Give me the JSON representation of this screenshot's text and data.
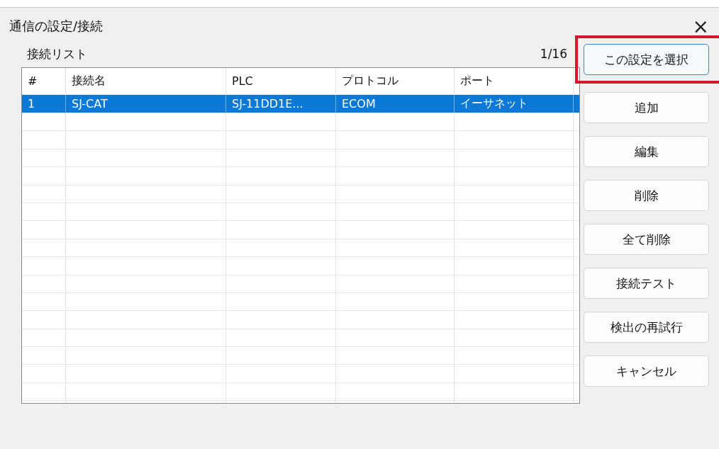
{
  "window": {
    "title": "通信の設定/接続",
    "close": "×"
  },
  "list": {
    "label": "接続リスト",
    "count": "1/16",
    "columns": [
      "#",
      "接続名",
      "PLC",
      "プロトコル",
      "ポート"
    ],
    "rows": [
      {
        "cells": [
          "1",
          "SJ-CAT",
          "SJ-11DD1E...",
          "ECOM",
          "イーサネット"
        ],
        "selected": true
      }
    ]
  },
  "buttons": [
    {
      "label": "この設定を選択",
      "highlighted": true
    },
    {
      "label": "追加",
      "highlighted": false
    },
    {
      "label": "編集",
      "highlighted": false
    },
    {
      "label": "削除",
      "highlighted": false
    },
    {
      "label": "全て削除",
      "highlighted": false
    },
    {
      "label": "接続テスト",
      "highlighted": false
    },
    {
      "label": "検出の再試行",
      "highlighted": false
    },
    {
      "label": "キャンセル",
      "highlighted": false
    }
  ]
}
